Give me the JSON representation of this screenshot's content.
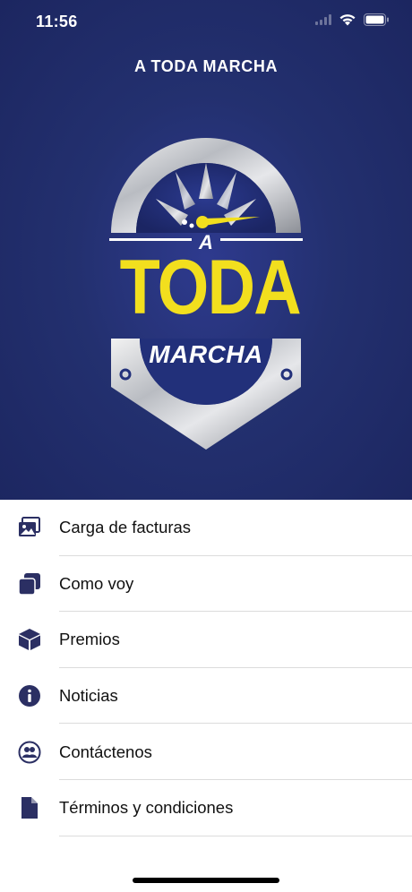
{
  "status_bar": {
    "time": "11:56"
  },
  "header": {
    "title": "A TODA MARCHA"
  },
  "logo": {
    "line1": "A",
    "line2": "TODA",
    "line3": "MARCHA"
  },
  "menu": {
    "items": [
      {
        "label": "Carga de facturas",
        "icon": "photos-icon"
      },
      {
        "label": "Como voy",
        "icon": "layers-icon"
      },
      {
        "label": "Premios",
        "icon": "box-icon"
      },
      {
        "label": "Noticias",
        "icon": "info-icon"
      },
      {
        "label": "Contáctenos",
        "icon": "users-icon"
      },
      {
        "label": "Términos y condiciones",
        "icon": "document-icon"
      }
    ]
  },
  "colors": {
    "brand_navy": "#23306f",
    "logo_yellow": "#f2df1e",
    "icon_color": "#2b2f63"
  }
}
